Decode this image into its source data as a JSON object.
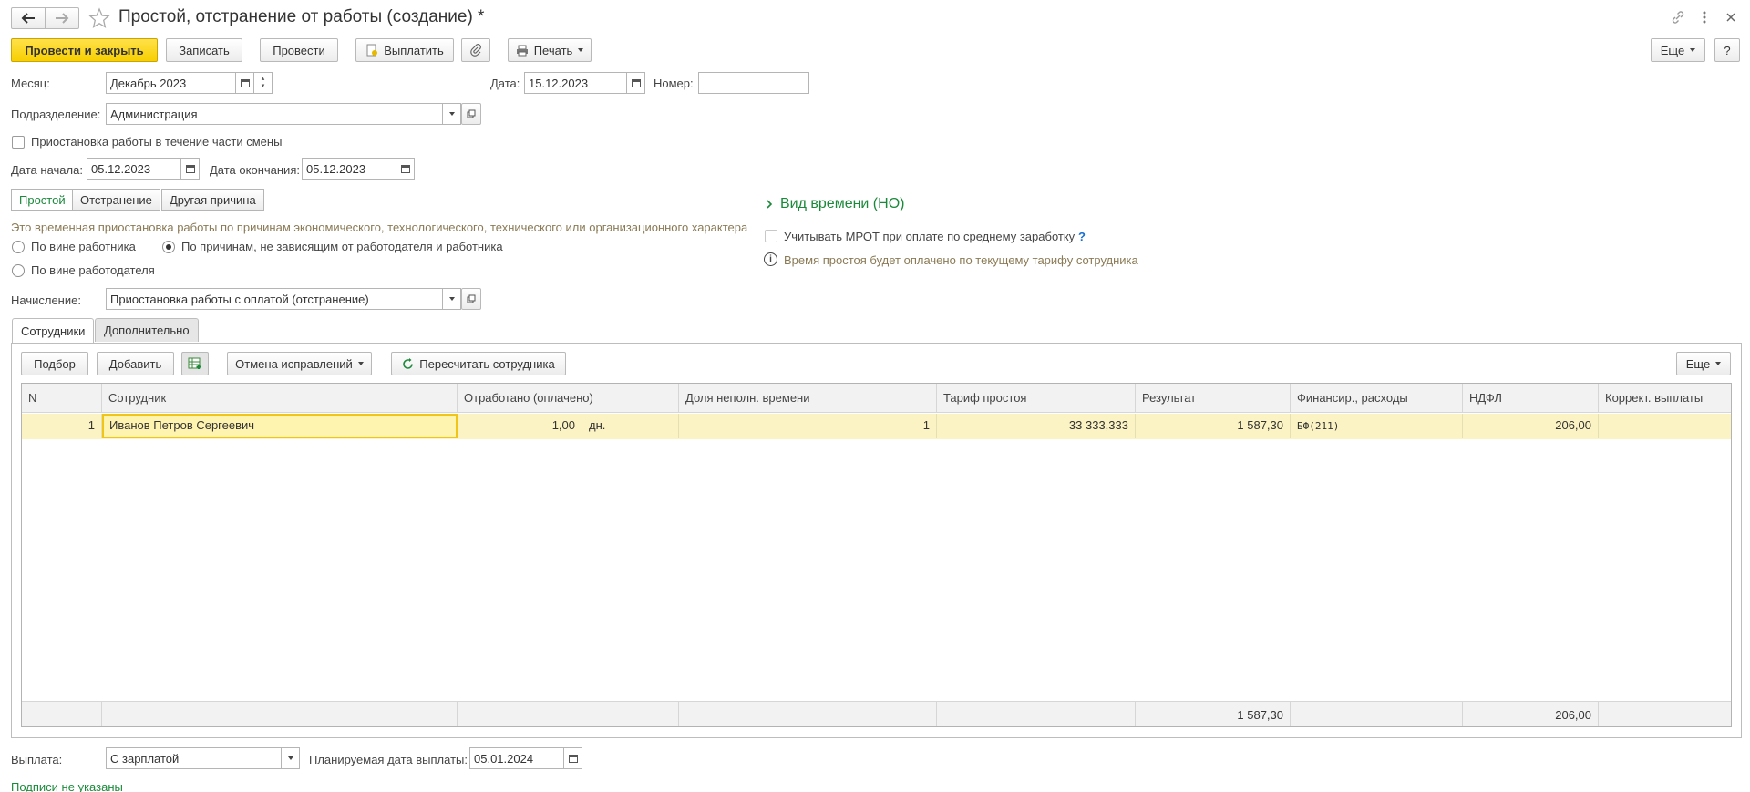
{
  "window": {
    "title": "Простой, отстранение от работы (создание) *"
  },
  "toolbar": {
    "post_close": "Провести и закрыть",
    "save": "Записать",
    "post": "Провести",
    "pay": "Выплатить",
    "print": "Печать",
    "more": "Еще",
    "help": "?"
  },
  "form": {
    "month_label": "Месяц:",
    "month_value": "Декабрь 2023",
    "date_label": "Дата:",
    "date_value": "15.12.2023",
    "number_label": "Номер:",
    "number_value": "",
    "department_label": "Подразделение:",
    "department_value": "Администрация",
    "partial_shift_label": "Приостановка работы в течение части смены",
    "start_label": "Дата начала:",
    "start_value": "05.12.2023",
    "end_label": "Дата окончания:",
    "end_value": "05.12.2023",
    "mode_tabs": [
      "Простой",
      "Отстранение",
      "Другая причина"
    ],
    "mode_selected": "Простой",
    "description": "Это временная приостановка работы по причинам экономического, технологического, технического или организационного характера",
    "radio_employee": "По вине работника",
    "radio_independent": "По причинам, не зависящим от работодателя и работника",
    "radio_employer": "По вине работодателя",
    "time_kind": "Вид времени (НО)",
    "mrot_label": "Учитывать МРОТ при оплате по среднему заработку",
    "mrot_help": "?",
    "info_text": "Время простоя будет оплачено по текущему тарифу сотрудника",
    "accrual_label": "Начисление:",
    "accrual_value": "Приостановка работы с оплатой (отстранение)"
  },
  "tabs": {
    "employees": "Сотрудники",
    "additional": "Дополнительно"
  },
  "table_toolbar": {
    "pick": "Подбор",
    "add": "Добавить",
    "cancel_corrections": "Отмена исправлений",
    "recalc": "Пересчитать сотрудника",
    "more": "Еще"
  },
  "table": {
    "columns": [
      "N",
      "Сотрудник",
      "Отработано (оплачено)",
      "Доля неполн. времени",
      "Тариф простоя",
      "Результат",
      "Финансир., расходы",
      "НДФЛ",
      "Коррект. выплаты"
    ],
    "rows": [
      {
        "n": "1",
        "employee": "Иванов Петров Сергеевич",
        "worked": "1,00",
        "unit": "дн.",
        "share": "1",
        "tariff": "33 333,333",
        "result": "1 587,30",
        "financing": "БФ(211)",
        "ndfl": "206,00",
        "correction": ""
      }
    ],
    "footer": {
      "result": "1 587,30",
      "ndfl": "206,00"
    }
  },
  "bottom": {
    "payment_label": "Выплата:",
    "payment_value": "С зарплатой",
    "planned_label": "Планируемая дата выплаты:",
    "planned_value": "05.01.2024",
    "signatures_link": "Подписи не указаны"
  },
  "colors": {
    "primary_button": "#f7cf00",
    "accent_green": "#1a8a3a",
    "row_highlight": "#fbf3c4",
    "description_text": "#8a7a55"
  }
}
